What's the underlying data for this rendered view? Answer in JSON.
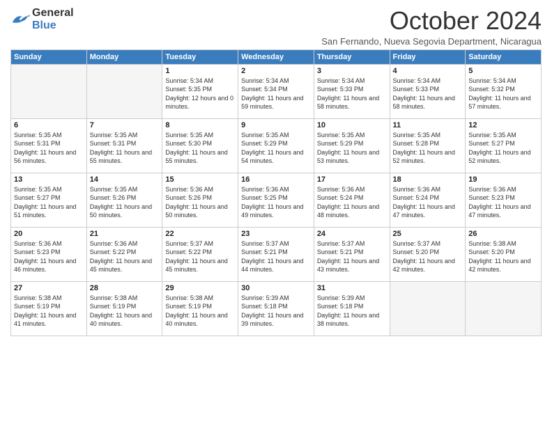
{
  "header": {
    "logo_general": "General",
    "logo_blue": "Blue",
    "month_title": "October 2024",
    "subtitle": "San Fernando, Nueva Segovia Department, Nicaragua"
  },
  "days_of_week": [
    "Sunday",
    "Monday",
    "Tuesday",
    "Wednesday",
    "Thursday",
    "Friday",
    "Saturday"
  ],
  "weeks": [
    [
      {
        "day": "",
        "empty": true
      },
      {
        "day": "",
        "empty": true
      },
      {
        "day": "1",
        "sunrise": "Sunrise: 5:34 AM",
        "sunset": "Sunset: 5:35 PM",
        "daylight": "Daylight: 12 hours and 0 minutes."
      },
      {
        "day": "2",
        "sunrise": "Sunrise: 5:34 AM",
        "sunset": "Sunset: 5:34 PM",
        "daylight": "Daylight: 11 hours and 59 minutes."
      },
      {
        "day": "3",
        "sunrise": "Sunrise: 5:34 AM",
        "sunset": "Sunset: 5:33 PM",
        "daylight": "Daylight: 11 hours and 58 minutes."
      },
      {
        "day": "4",
        "sunrise": "Sunrise: 5:34 AM",
        "sunset": "Sunset: 5:33 PM",
        "daylight": "Daylight: 11 hours and 58 minutes."
      },
      {
        "day": "5",
        "sunrise": "Sunrise: 5:34 AM",
        "sunset": "Sunset: 5:32 PM",
        "daylight": "Daylight: 11 hours and 57 minutes."
      }
    ],
    [
      {
        "day": "6",
        "sunrise": "Sunrise: 5:35 AM",
        "sunset": "Sunset: 5:31 PM",
        "daylight": "Daylight: 11 hours and 56 minutes."
      },
      {
        "day": "7",
        "sunrise": "Sunrise: 5:35 AM",
        "sunset": "Sunset: 5:31 PM",
        "daylight": "Daylight: 11 hours and 55 minutes."
      },
      {
        "day": "8",
        "sunrise": "Sunrise: 5:35 AM",
        "sunset": "Sunset: 5:30 PM",
        "daylight": "Daylight: 11 hours and 55 minutes."
      },
      {
        "day": "9",
        "sunrise": "Sunrise: 5:35 AM",
        "sunset": "Sunset: 5:29 PM",
        "daylight": "Daylight: 11 hours and 54 minutes."
      },
      {
        "day": "10",
        "sunrise": "Sunrise: 5:35 AM",
        "sunset": "Sunset: 5:29 PM",
        "daylight": "Daylight: 11 hours and 53 minutes."
      },
      {
        "day": "11",
        "sunrise": "Sunrise: 5:35 AM",
        "sunset": "Sunset: 5:28 PM",
        "daylight": "Daylight: 11 hours and 52 minutes."
      },
      {
        "day": "12",
        "sunrise": "Sunrise: 5:35 AM",
        "sunset": "Sunset: 5:27 PM",
        "daylight": "Daylight: 11 hours and 52 minutes."
      }
    ],
    [
      {
        "day": "13",
        "sunrise": "Sunrise: 5:35 AM",
        "sunset": "Sunset: 5:27 PM",
        "daylight": "Daylight: 11 hours and 51 minutes."
      },
      {
        "day": "14",
        "sunrise": "Sunrise: 5:35 AM",
        "sunset": "Sunset: 5:26 PM",
        "daylight": "Daylight: 11 hours and 50 minutes."
      },
      {
        "day": "15",
        "sunrise": "Sunrise: 5:36 AM",
        "sunset": "Sunset: 5:26 PM",
        "daylight": "Daylight: 11 hours and 50 minutes."
      },
      {
        "day": "16",
        "sunrise": "Sunrise: 5:36 AM",
        "sunset": "Sunset: 5:25 PM",
        "daylight": "Daylight: 11 hours and 49 minutes."
      },
      {
        "day": "17",
        "sunrise": "Sunrise: 5:36 AM",
        "sunset": "Sunset: 5:24 PM",
        "daylight": "Daylight: 11 hours and 48 minutes."
      },
      {
        "day": "18",
        "sunrise": "Sunrise: 5:36 AM",
        "sunset": "Sunset: 5:24 PM",
        "daylight": "Daylight: 11 hours and 47 minutes."
      },
      {
        "day": "19",
        "sunrise": "Sunrise: 5:36 AM",
        "sunset": "Sunset: 5:23 PM",
        "daylight": "Daylight: 11 hours and 47 minutes."
      }
    ],
    [
      {
        "day": "20",
        "sunrise": "Sunrise: 5:36 AM",
        "sunset": "Sunset: 5:23 PM",
        "daylight": "Daylight: 11 hours and 46 minutes."
      },
      {
        "day": "21",
        "sunrise": "Sunrise: 5:36 AM",
        "sunset": "Sunset: 5:22 PM",
        "daylight": "Daylight: 11 hours and 45 minutes."
      },
      {
        "day": "22",
        "sunrise": "Sunrise: 5:37 AM",
        "sunset": "Sunset: 5:22 PM",
        "daylight": "Daylight: 11 hours and 45 minutes."
      },
      {
        "day": "23",
        "sunrise": "Sunrise: 5:37 AM",
        "sunset": "Sunset: 5:21 PM",
        "daylight": "Daylight: 11 hours and 44 minutes."
      },
      {
        "day": "24",
        "sunrise": "Sunrise: 5:37 AM",
        "sunset": "Sunset: 5:21 PM",
        "daylight": "Daylight: 11 hours and 43 minutes."
      },
      {
        "day": "25",
        "sunrise": "Sunrise: 5:37 AM",
        "sunset": "Sunset: 5:20 PM",
        "daylight": "Daylight: 11 hours and 42 minutes."
      },
      {
        "day": "26",
        "sunrise": "Sunrise: 5:38 AM",
        "sunset": "Sunset: 5:20 PM",
        "daylight": "Daylight: 11 hours and 42 minutes."
      }
    ],
    [
      {
        "day": "27",
        "sunrise": "Sunrise: 5:38 AM",
        "sunset": "Sunset: 5:19 PM",
        "daylight": "Daylight: 11 hours and 41 minutes."
      },
      {
        "day": "28",
        "sunrise": "Sunrise: 5:38 AM",
        "sunset": "Sunset: 5:19 PM",
        "daylight": "Daylight: 11 hours and 40 minutes."
      },
      {
        "day": "29",
        "sunrise": "Sunrise: 5:38 AM",
        "sunset": "Sunset: 5:19 PM",
        "daylight": "Daylight: 11 hours and 40 minutes."
      },
      {
        "day": "30",
        "sunrise": "Sunrise: 5:39 AM",
        "sunset": "Sunset: 5:18 PM",
        "daylight": "Daylight: 11 hours and 39 minutes."
      },
      {
        "day": "31",
        "sunrise": "Sunrise: 5:39 AM",
        "sunset": "Sunset: 5:18 PM",
        "daylight": "Daylight: 11 hours and 38 minutes."
      },
      {
        "day": "",
        "empty": true
      },
      {
        "day": "",
        "empty": true
      }
    ]
  ]
}
